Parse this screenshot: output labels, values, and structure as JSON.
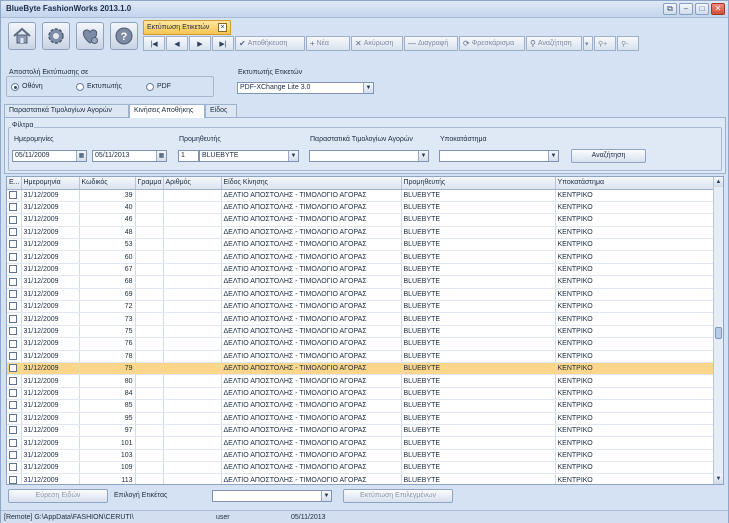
{
  "app": {
    "title": "BlueByte FashionWorks 2013.1.0"
  },
  "window_buttons": [
    "restore-icon",
    "minimize-icon",
    "maximize-icon",
    "close-icon"
  ],
  "doc_tab": {
    "label": "Εκτύπωση Ετικετών"
  },
  "toolbar": {
    "big_icons": [
      "home-icon",
      "settings-gear-icon",
      "favorites-heart-icon",
      "help-icon"
    ],
    "save": "Αποθήκευση",
    "new": "Νέα",
    "cancel": "Ακύρωση",
    "delete": "Διαγραφή",
    "refresh": "Φρεσκάρισμα",
    "search": "Αναζήτηση"
  },
  "print_target": {
    "label": "Αποστολή Εκτύπωσης σε",
    "options": [
      "Οθόνη",
      "Εκτυπωτής",
      "PDF"
    ],
    "selected": "Οθόνη"
  },
  "label_printer": {
    "label": "Εκτυπωτής Ετικετών",
    "value": "PDF-XChange Lite 3.0"
  },
  "tabs": [
    "Παραστατικά Τιμολογίων Αγορών",
    "Κινήσεις Αποθήκης",
    "Είδος"
  ],
  "active_tab": "Κινήσεις Αποθήκης",
  "filters": {
    "legend": "Φίλτρα",
    "dates_label": "Ημερομηνίες",
    "date_from": "05/11/2009",
    "date_to": "05/11/2013",
    "supplier_label": "Προμηθευτής",
    "supplier_code": "1",
    "supplier_name": "BLUEBYTE",
    "purchase_docs_label": "Παραστατικά Τιμολογίων Αγορών",
    "purchase_docs_value": "",
    "branch_label": "Υποκατάστημα",
    "branch_value": "",
    "search_button": "Αναζήτηση"
  },
  "grid": {
    "columns": [
      "Ε...",
      "Ημερομηνία",
      "Κωδικός",
      "Γραμμα",
      "Αριθμός",
      "Είδος Κίνησης",
      "Προμηθευτής",
      "Υποκατάστημα"
    ],
    "selected_index": 14,
    "rows": [
      {
        "date": "31/12/2009",
        "code": "39",
        "type": "ΔΕΛΤΙΟ ΑΠΟΣΤΟΛΗΣ - ΤΙΜΟΛΟΓΙΟ ΑΓΟΡΑΣ",
        "supplier": "BLUEBYTE",
        "branch": "ΚΕΝΤΡΙΚΟ"
      },
      {
        "date": "31/12/2009",
        "code": "40",
        "type": "ΔΕΛΤΙΟ ΑΠΟΣΤΟΛΗΣ - ΤΙΜΟΛΟΓΙΟ ΑΓΟΡΑΣ",
        "supplier": "BLUEBYTE",
        "branch": "ΚΕΝΤΡΙΚΟ"
      },
      {
        "date": "31/12/2009",
        "code": "46",
        "type": "ΔΕΛΤΙΟ ΑΠΟΣΤΟΛΗΣ - ΤΙΜΟΛΟΓΙΟ ΑΓΟΡΑΣ",
        "supplier": "BLUEBYTE",
        "branch": "ΚΕΝΤΡΙΚΟ"
      },
      {
        "date": "31/12/2009",
        "code": "48",
        "type": "ΔΕΛΤΙΟ ΑΠΟΣΤΟΛΗΣ - ΤΙΜΟΛΟΓΙΟ ΑΓΟΡΑΣ",
        "supplier": "BLUEBYTE",
        "branch": "ΚΕΝΤΡΙΚΟ"
      },
      {
        "date": "31/12/2009",
        "code": "53",
        "type": "ΔΕΛΤΙΟ ΑΠΟΣΤΟΛΗΣ - ΤΙΜΟΛΟΓΙΟ ΑΓΟΡΑΣ",
        "supplier": "BLUEBYTE",
        "branch": "ΚΕΝΤΡΙΚΟ"
      },
      {
        "date": "31/12/2009",
        "code": "60",
        "type": "ΔΕΛΤΙΟ ΑΠΟΣΤΟΛΗΣ - ΤΙΜΟΛΟΓΙΟ ΑΓΟΡΑΣ",
        "supplier": "BLUEBYTE",
        "branch": "ΚΕΝΤΡΙΚΟ"
      },
      {
        "date": "31/12/2009",
        "code": "67",
        "type": "ΔΕΛΤΙΟ ΑΠΟΣΤΟΛΗΣ - ΤΙΜΟΛΟΓΙΟ ΑΓΟΡΑΣ",
        "supplier": "BLUEBYTE",
        "branch": "ΚΕΝΤΡΙΚΟ"
      },
      {
        "date": "31/12/2009",
        "code": "68",
        "type": "ΔΕΛΤΙΟ ΑΠΟΣΤΟΛΗΣ - ΤΙΜΟΛΟΓΙΟ ΑΓΟΡΑΣ",
        "supplier": "BLUEBYTE",
        "branch": "ΚΕΝΤΡΙΚΟ"
      },
      {
        "date": "31/12/2009",
        "code": "69",
        "type": "ΔΕΛΤΙΟ ΑΠΟΣΤΟΛΗΣ - ΤΙΜΟΛΟΓΙΟ ΑΓΟΡΑΣ",
        "supplier": "BLUEBYTE",
        "branch": "ΚΕΝΤΡΙΚΟ"
      },
      {
        "date": "31/12/2009",
        "code": "72",
        "type": "ΔΕΛΤΙΟ ΑΠΟΣΤΟΛΗΣ - ΤΙΜΟΛΟΓΙΟ ΑΓΟΡΑΣ",
        "supplier": "BLUEBYTE",
        "branch": "ΚΕΝΤΡΙΚΟ"
      },
      {
        "date": "31/12/2009",
        "code": "73",
        "type": "ΔΕΛΤΙΟ ΑΠΟΣΤΟΛΗΣ - ΤΙΜΟΛΟΓΙΟ ΑΓΟΡΑΣ",
        "supplier": "BLUEBYTE",
        "branch": "ΚΕΝΤΡΙΚΟ"
      },
      {
        "date": "31/12/2009",
        "code": "75",
        "type": "ΔΕΛΤΙΟ ΑΠΟΣΤΟΛΗΣ - ΤΙΜΟΛΟΓΙΟ ΑΓΟΡΑΣ",
        "supplier": "BLUEBYTE",
        "branch": "ΚΕΝΤΡΙΚΟ"
      },
      {
        "date": "31/12/2009",
        "code": "76",
        "type": "ΔΕΛΤΙΟ ΑΠΟΣΤΟΛΗΣ - ΤΙΜΟΛΟΓΙΟ ΑΓΟΡΑΣ",
        "supplier": "BLUEBYTE",
        "branch": "ΚΕΝΤΡΙΚΟ"
      },
      {
        "date": "31/12/2009",
        "code": "78",
        "type": "ΔΕΛΤΙΟ ΑΠΟΣΤΟΛΗΣ - ΤΙΜΟΛΟΓΙΟ ΑΓΟΡΑΣ",
        "supplier": "BLUEBYTE",
        "branch": "ΚΕΝΤΡΙΚΟ"
      },
      {
        "date": "31/12/2009",
        "code": "79",
        "type": "ΔΕΛΤΙΟ ΑΠΟΣΤΟΛΗΣ - ΤΙΜΟΛΟΓΙΟ ΑΓΟΡΑΣ",
        "supplier": "BLUEBYTE",
        "branch": "ΚΕΝΤΡΙΚΟ"
      },
      {
        "date": "31/12/2009",
        "code": "80",
        "type": "ΔΕΛΤΙΟ ΑΠΟΣΤΟΛΗΣ - ΤΙΜΟΛΟΓΙΟ ΑΓΟΡΑΣ",
        "supplier": "BLUEBYTE",
        "branch": "ΚΕΝΤΡΙΚΟ"
      },
      {
        "date": "31/12/2009",
        "code": "84",
        "type": "ΔΕΛΤΙΟ ΑΠΟΣΤΟΛΗΣ - ΤΙΜΟΛΟΓΙΟ ΑΓΟΡΑΣ",
        "supplier": "BLUEBYTE",
        "branch": "ΚΕΝΤΡΙΚΟ"
      },
      {
        "date": "31/12/2009",
        "code": "85",
        "type": "ΔΕΛΤΙΟ ΑΠΟΣΤΟΛΗΣ - ΤΙΜΟΛΟΓΙΟ ΑΓΟΡΑΣ",
        "supplier": "BLUEBYTE",
        "branch": "ΚΕΝΤΡΙΚΟ"
      },
      {
        "date": "31/12/2009",
        "code": "95",
        "type": "ΔΕΛΤΙΟ ΑΠΟΣΤΟΛΗΣ - ΤΙΜΟΛΟΓΙΟ ΑΓΟΡΑΣ",
        "supplier": "BLUEBYTE",
        "branch": "ΚΕΝΤΡΙΚΟ"
      },
      {
        "date": "31/12/2009",
        "code": "97",
        "type": "ΔΕΛΤΙΟ ΑΠΟΣΤΟΛΗΣ - ΤΙΜΟΛΟΓΙΟ ΑΓΟΡΑΣ",
        "supplier": "BLUEBYTE",
        "branch": "ΚΕΝΤΡΙΚΟ"
      },
      {
        "date": "31/12/2009",
        "code": "101",
        "type": "ΔΕΛΤΙΟ ΑΠΟΣΤΟΛΗΣ - ΤΙΜΟΛΟΓΙΟ ΑΓΟΡΑΣ",
        "supplier": "BLUEBYTE",
        "branch": "ΚΕΝΤΡΙΚΟ"
      },
      {
        "date": "31/12/2009",
        "code": "103",
        "type": "ΔΕΛΤΙΟ ΑΠΟΣΤΟΛΗΣ - ΤΙΜΟΛΟΓΙΟ ΑΓΟΡΑΣ",
        "supplier": "BLUEBYTE",
        "branch": "ΚΕΝΤΡΙΚΟ"
      },
      {
        "date": "31/12/2009",
        "code": "109",
        "type": "ΔΕΛΤΙΟ ΑΠΟΣΤΟΛΗΣ - ΤΙΜΟΛΟΓΙΟ ΑΓΟΡΑΣ",
        "supplier": "BLUEBYTE",
        "branch": "ΚΕΝΤΡΙΚΟ"
      },
      {
        "date": "31/12/2009",
        "code": "113",
        "type": "ΔΕΛΤΙΟ ΑΠΟΣΤΟΛΗΣ - ΤΙΜΟΛΟΓΙΟ ΑΓΟΡΑΣ",
        "supplier": "BLUEBYTE",
        "branch": "ΚΕΝΤΡΙΚΟ"
      }
    ]
  },
  "bottom": {
    "find_items_button": "Εύρεση Ειδών",
    "label_selection_label": "Επιλογή Ετικέτας",
    "label_selection_value": "",
    "print_selected_button": "Εκτύπωση Επιλεγμένων"
  },
  "status": {
    "path": "[Remote] G:\\AppData\\FASHION\\CERUTI\\",
    "user": "user",
    "date": "05/11/2013"
  },
  "colors": {
    "selected_row": "#fbd68a",
    "doc_tab": "#f7c452",
    "window_bg": "#d5e2f3"
  }
}
